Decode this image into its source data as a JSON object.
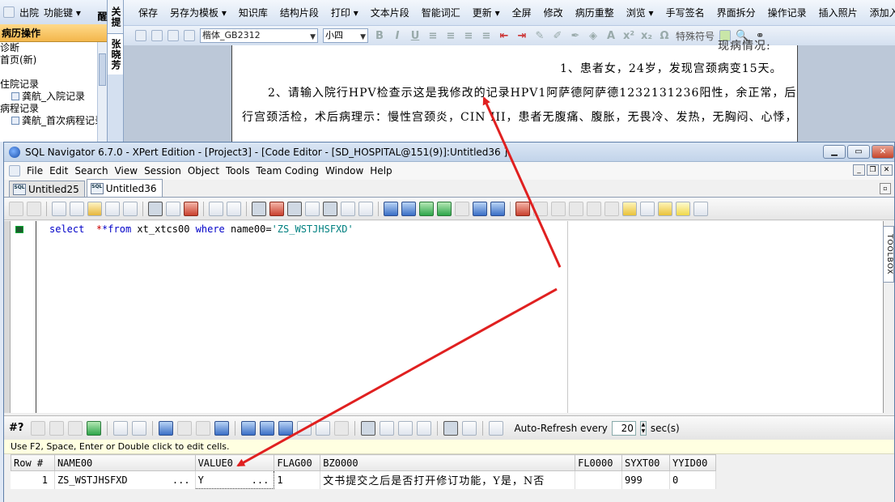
{
  "emr": {
    "left_top": {
      "discharge": "出院",
      "function_key": "功能键"
    },
    "left_header": "病历操作",
    "tree": [
      "诊断",
      "首页(新)",
      "",
      "住院记录",
      "龚航_入院记录",
      "病程记录",
      "龚航_首次病程记录"
    ],
    "vert_tabs": {
      "reminder": "关提醒",
      "person": "张晓芳"
    },
    "toolbar1": [
      "保存",
      "另存为模板",
      "知识库",
      "结构片段",
      "打印",
      "文本片段",
      "智能词汇",
      "更新",
      "全屏",
      "修改",
      "病历重整",
      "浏览",
      "手写签名",
      "界面拆分",
      "操作记录",
      "插入照片",
      "添加入院"
    ],
    "font_name": "楷体_GB2312",
    "font_size": "小四",
    "special_symbol": "特殊符号",
    "doc_lines": {
      "header": "现病情况:",
      "line1": "1、患者女，24岁，发现宫颈病变15天。",
      "line2": "2、请输入院行HPV检查示这是我修改的记录HPV1阿萨德阿萨德1232131236阳性，余正常，后",
      "line3": "行宫颈活检，术后病理示：慢性宫颈炎，CIN III，患者无腹痛、腹胀，无畏冷、发热，无胸闷、心悸，"
    }
  },
  "sqlnav": {
    "title": "SQL Navigator 6.7.0 - XPert Edition - [Project3] - [Code Editor - [SD_HOSPITAL@151(9)]:Untitled36 ]",
    "menu": [
      "File",
      "Edit",
      "Search",
      "View",
      "Session",
      "Object",
      "Tools",
      "Team Coding",
      "Window",
      "Help"
    ],
    "tabs": [
      {
        "label": "Untitled25",
        "active": false
      },
      {
        "label": "Untitled36",
        "active": true
      }
    ],
    "code": {
      "select": "select",
      "star_from": "*from",
      "table": " xt_xtcs00 ",
      "where": "where",
      "cond": " name00=",
      "value": "'ZS_WSTJHSFXD'"
    },
    "toolbox_label": "TOOLBOX",
    "grid_toolbar": {
      "hash": "#?",
      "auto_refresh": "Auto-Refresh every",
      "interval": "20",
      "unit": "sec(s)"
    },
    "info": "Use F2, Space, Enter or Double click to edit cells.",
    "grid": {
      "columns": [
        "Row #",
        "NAME00",
        "VALUE0",
        "FLAG00",
        "BZ0000",
        "FL0000",
        "SYXT00",
        "YYID00"
      ],
      "rows": [
        {
          "row": "1",
          "name": "ZS_WSTJHSFXD",
          "name_ell": "...",
          "value": "Y",
          "value_ell": "...",
          "flag": "1",
          "bz": "文书提交之后是否打开修订功能，Y是，N否",
          "fl": "",
          "syxt": "999",
          "yyid": "0"
        }
      ]
    }
  },
  "colors": {
    "annotation_arrow": "#e02020",
    "keyword": "#0000c8",
    "string": "#008080"
  }
}
